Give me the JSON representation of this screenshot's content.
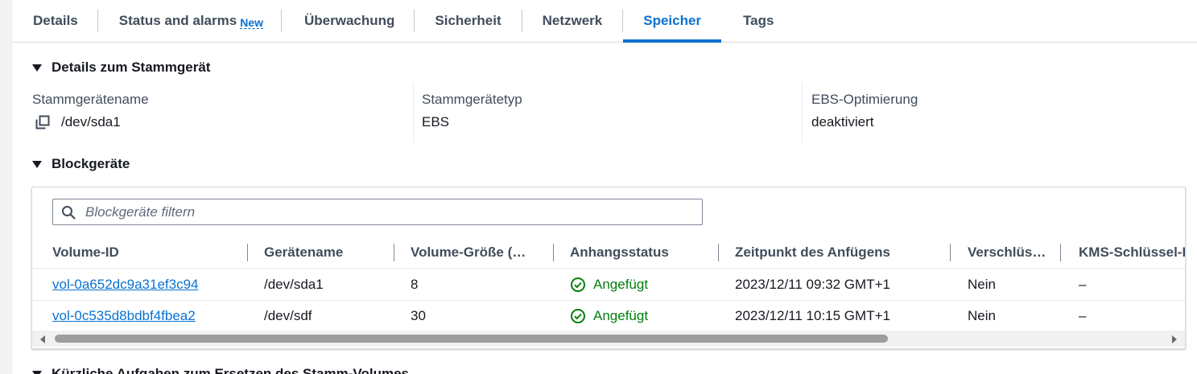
{
  "tabs": [
    {
      "label": "Details"
    },
    {
      "label": "Status and alarms",
      "badge": "New"
    },
    {
      "label": "Überwachung"
    },
    {
      "label": "Sicherheit"
    },
    {
      "label": "Netzwerk"
    },
    {
      "label": "Speicher",
      "active": true
    },
    {
      "label": "Tags"
    }
  ],
  "root_device": {
    "section_title": "Details zum Stammgerät",
    "name_label": "Stammgerätename",
    "name_value": "/dev/sda1",
    "type_label": "Stammgerätetyp",
    "type_value": "EBS",
    "ebs_label": "EBS-Optimierung",
    "ebs_value": "deaktiviert"
  },
  "block_devices": {
    "section_title": "Blockgeräte",
    "filter_placeholder": "Blockgeräte filtern",
    "columns": [
      "Volume-ID",
      "Gerätename",
      "Volume-Größe (…",
      "Anhangsstatus",
      "Zeitpunkt des Anfügens",
      "Verschlüs…",
      "KMS-Schlüssel-I"
    ],
    "rows": [
      {
        "volume_id": "vol-0a652dc9a31ef3c94",
        "device": "/dev/sda1",
        "size": "8",
        "status": "Angefügt",
        "attach_time": "2023/12/11 09:32 GMT+1",
        "encrypted": "Nein",
        "kms": "–"
      },
      {
        "volume_id": "vol-0c535d8bdbf4fbea2",
        "device": "/dev/sdf",
        "size": "30",
        "status": "Angefügt",
        "attach_time": "2023/12/11 10:15 GMT+1",
        "encrypted": "Nein",
        "kms": "–"
      }
    ]
  },
  "next_section": {
    "title": "Kürzliche Aufgaben zum Ersetzen des Stamm-Volumes"
  },
  "colors": {
    "accent": "#0972d3",
    "success": "#037f0c",
    "text": "#16191f",
    "muted": "#414d5c"
  }
}
